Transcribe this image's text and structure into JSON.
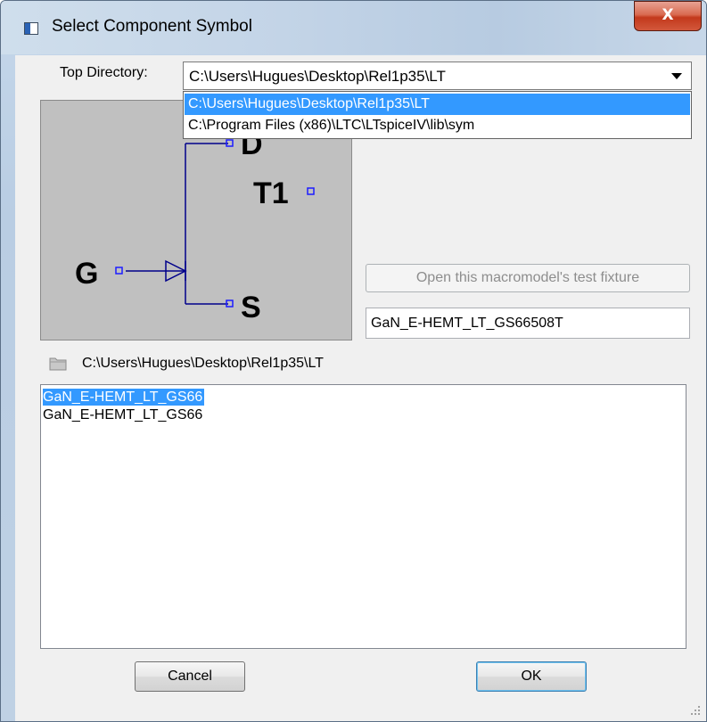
{
  "window": {
    "title": "Select Component Symbol",
    "close_glyph": "X"
  },
  "top_directory": {
    "label": "Top Directory:",
    "value": "C:\\Users\\Hugues\\Desktop\\Rel1p35\\LT",
    "options": [
      "C:\\Users\\Hugues\\Desktop\\Rel1p35\\LT",
      "C:\\Program Files (x86)\\LTC\\LTspiceIV\\lib\\sym"
    ],
    "selected_index": 0
  },
  "symbol_preview": {
    "pin_d": "D",
    "pin_g": "G",
    "pin_s": "S",
    "instance": "T1",
    "background": "#c0c0c0",
    "wire_color": "#00008b"
  },
  "test_fixture_button": {
    "label": "Open this macromodel's test fixture",
    "enabled": false
  },
  "model_name": "GaN_E-HEMT_LT_GS66508T",
  "current_path": "C:\\Users\\Hugues\\Desktop\\Rel1p35\\LT",
  "file_list": {
    "items": [
      "GaN_E-HEMT_LT_GS66",
      "GaN_E-HEMT_LT_GS66"
    ],
    "selected_index": 0
  },
  "buttons": {
    "cancel": "Cancel",
    "ok": "OK"
  },
  "colors": {
    "selection": "#3399ff",
    "close_button": "#c3391c"
  }
}
